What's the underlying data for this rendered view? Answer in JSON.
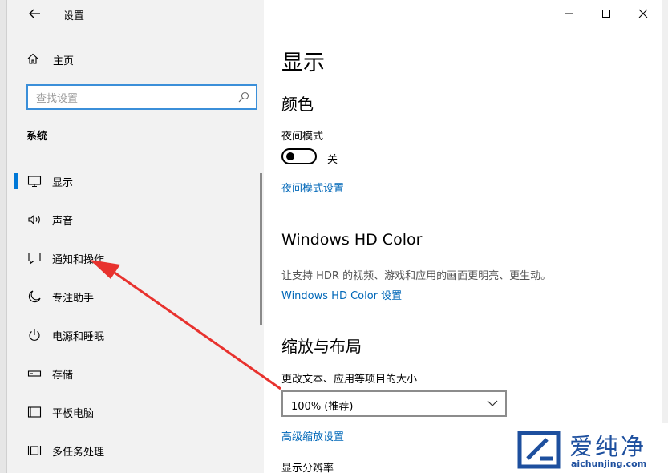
{
  "window": {
    "title": "设置",
    "controls": {
      "minimize": "minimize-icon",
      "maximize": "maximize-icon",
      "close": "close-icon"
    }
  },
  "sidebar": {
    "home_label": "主页",
    "search_placeholder": "查找设置",
    "section_label": "系统",
    "items": [
      {
        "label": "显示",
        "icon": "monitor-icon",
        "active": true
      },
      {
        "label": "声音",
        "icon": "speaker-icon"
      },
      {
        "label": "通知和操作",
        "icon": "notification-icon"
      },
      {
        "label": "专注助手",
        "icon": "moon-icon"
      },
      {
        "label": "电源和睡眠",
        "icon": "power-icon"
      },
      {
        "label": "存储",
        "icon": "storage-icon"
      },
      {
        "label": "平板电脑",
        "icon": "tablet-icon"
      },
      {
        "label": "多任务处理",
        "icon": "multitask-icon"
      }
    ]
  },
  "main": {
    "page_title": "显示",
    "color_section": {
      "heading": "颜色",
      "night_mode_label": "夜间模式",
      "night_mode_state": "关",
      "night_mode_on": false,
      "night_mode_link": "夜间模式设置"
    },
    "hd_section": {
      "heading": "Windows HD Color",
      "description": "让支持 HDR 的视频、游戏和应用的画面更明亮、更生动。",
      "link": "Windows HD Color 设置"
    },
    "scale_section": {
      "heading": "缩放与布局",
      "size_label": "更改文本、应用等项目的大小",
      "size_value": "100% (推荐)",
      "advanced_link": "高级缩放设置",
      "resolution_label": "显示分辨率"
    }
  },
  "watermark": {
    "name": "爱纯净",
    "url": "aichunjing.com"
  },
  "colors": {
    "accent": "#0078d7",
    "link": "#0067b8",
    "arrow": "#e8322e",
    "sidebar_bg": "#f2f2f2"
  }
}
